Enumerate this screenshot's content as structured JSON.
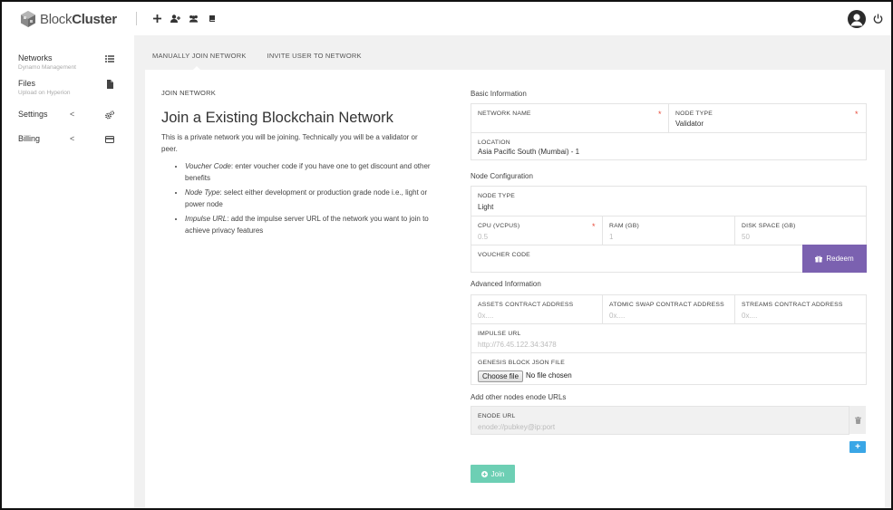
{
  "app": {
    "brand_light": "Block",
    "brand_bold": "Cluster"
  },
  "toolbar": {
    "icons": [
      "plus-icon",
      "add-user-icon",
      "users-icon",
      "book-icon"
    ]
  },
  "sidebar": {
    "items": [
      {
        "label": "Networks",
        "sub": "Dynamo Management",
        "icon": "list-icon"
      },
      {
        "label": "Files",
        "sub": "Upload on Hyperion",
        "icon": "file-icon"
      },
      {
        "label": "Settings",
        "chevron": "<",
        "icon": "cogs-icon"
      },
      {
        "label": "Billing",
        "chevron": "<",
        "icon": "credit-card-icon"
      }
    ]
  },
  "tabs": [
    "MANUALLY JOIN NETWORK",
    "INVITE USER TO NETWORK"
  ],
  "left": {
    "section_title": "JOIN NETWORK",
    "heading": "Join a Existing Blockchain Network",
    "intro": "This is a private network you will be joining. Technically you will be a validator or peer.",
    "bullets": [
      {
        "term": "Voucher Code",
        "text": ": enter voucher code if you have one to get discount and other benefits"
      },
      {
        "term": "Node Type",
        "text": ": select either development or production grade node i.e., light or power node"
      },
      {
        "term": "Impulse URL",
        "text": ": add the impulse server URL of the network you want to join to achieve privacy features"
      }
    ]
  },
  "basic": {
    "title": "Basic Information",
    "network_name_label": "NETWORK NAME",
    "node_type_label": "NODE TYPE",
    "node_type_value": "Validator",
    "location_label": "LOCATION",
    "location_value": "Asia Pacific South (Mumbai) - 1",
    "required_mark": "*"
  },
  "node_config": {
    "title": "Node Configuration",
    "node_type_label": "NODE TYPE",
    "node_type_value": "Light",
    "cpu_label": "CPU (VCPUS)",
    "cpu_value": "0.5",
    "ram_label": "RAM (GB)",
    "ram_value": "1",
    "disk_label": "DISK SPACE (GB)",
    "disk_value": "50",
    "voucher_label": "VOUCHER CODE",
    "redeem_label": "Redeem"
  },
  "advanced": {
    "title": "Advanced Information",
    "assets_label": "ASSETS CONTRACT ADDRESS",
    "assets_placeholder": "0x....",
    "atomic_label": "ATOMIC SWAP CONTRACT ADDRESS",
    "atomic_placeholder": "0x....",
    "streams_label": "STREAMS CONTRACT ADDRESS",
    "streams_placeholder": "0x....",
    "impulse_label": "IMPULSE URL",
    "impulse_placeholder": "http://76.45.122.34:3478",
    "genesis_label": "GENESIS BLOCK JSON FILE",
    "choose_file_label": "Choose file",
    "no_file_label": "No file chosen"
  },
  "enode": {
    "title": "Add other nodes enode URLs",
    "label": "ENODE URL",
    "placeholder": "enode://pubkey@ip:port",
    "add_label": "+"
  },
  "actions": {
    "join_label": "Join"
  },
  "colors": {
    "redeem": "#7b61b0",
    "add": "#3aa6e6",
    "join": "#6dcfb4",
    "required": "#e74c3c"
  }
}
